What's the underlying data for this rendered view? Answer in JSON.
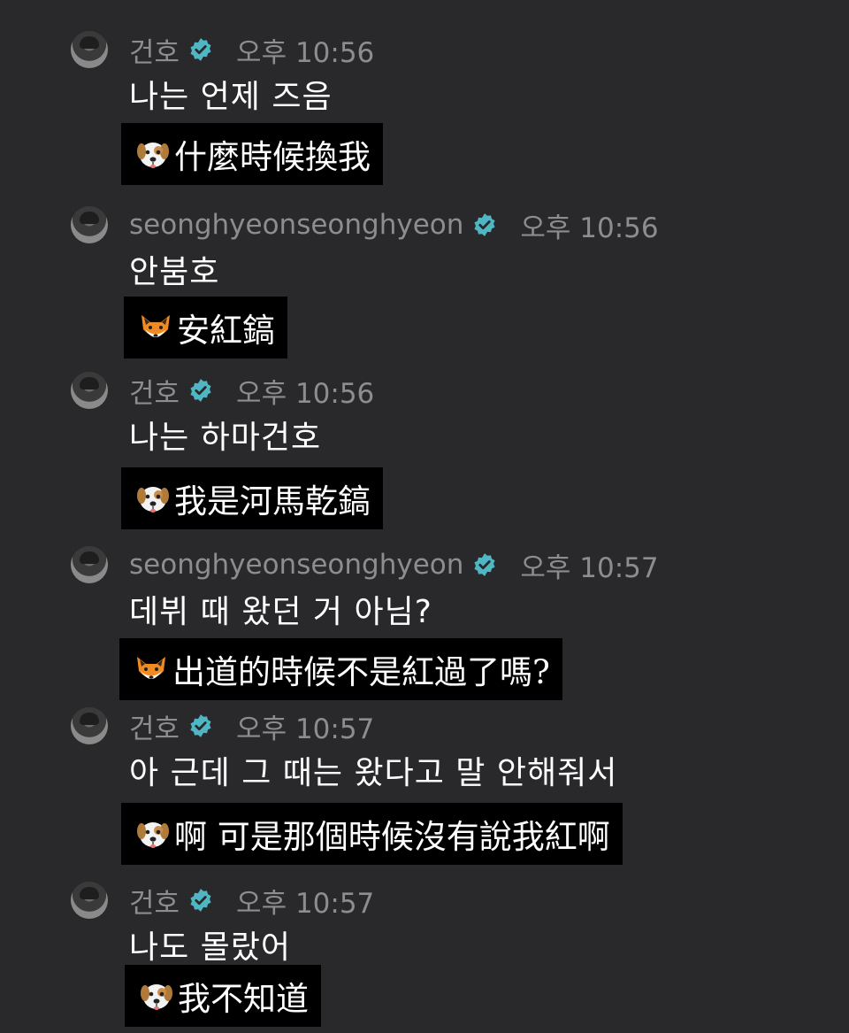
{
  "messages": [
    {
      "sender": "건호",
      "time": "오후 10:56",
      "text": "나는 언제 즈음",
      "subtitle_icon": "dog-icon",
      "subtitle": "什麼時候換我"
    },
    {
      "sender": "seonghyeonseonghyeon",
      "time": "오후 10:56",
      "text": "안붐호",
      "subtitle_icon": "fox-icon",
      "subtitle": "安紅鎬"
    },
    {
      "sender": "건호",
      "time": "오후 10:56",
      "text": "나는 하마건호",
      "subtitle_icon": "dog-icon",
      "subtitle": "我是河馬乾鎬"
    },
    {
      "sender": "seonghyeonseonghyeon",
      "time": "오후 10:57",
      "text": "데뷔 때 왔던 거 아님?",
      "subtitle_icon": "fox-icon",
      "subtitle": "出道的時候不是紅過了嗎?"
    },
    {
      "sender": "건호",
      "time": "오후 10:57",
      "text": "아 근데 그 때는 왔다고 말 안해줘서",
      "subtitle_icon": "dog-icon",
      "subtitle": "啊 可是那個時候沒有說我紅啊"
    },
    {
      "sender": "건호",
      "time": "오후 10:57",
      "text": "나도 몰랐어",
      "subtitle_icon": "dog-icon",
      "subtitle": "我不知道"
    }
  ],
  "colors": {
    "background": "#29292b",
    "verified_badge": "#4fb6c4",
    "meta_text": "#8d8d90",
    "subtitle_bg": "#000000"
  }
}
